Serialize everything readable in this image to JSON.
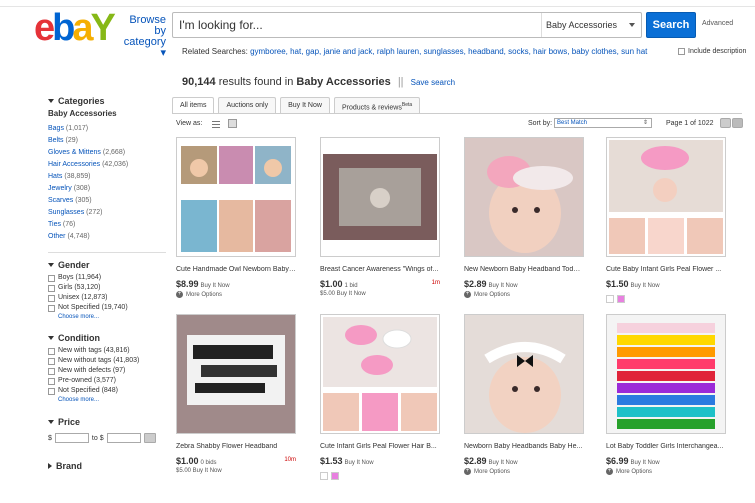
{
  "header": {
    "logo": {
      "e": "e",
      "b": "b",
      "a": "a",
      "y": "Y"
    },
    "browse_line1": "Browse by",
    "browse_line2": "category ▾",
    "search_placeholder": "I'm looking for...",
    "category_select": "Baby Accessories",
    "search_button": "Search",
    "advanced_link": "Advanced",
    "include_description": "Include description"
  },
  "related": {
    "label": "Related Searches:",
    "terms": [
      "gymboree,",
      "hat,",
      "gap,",
      "janie and jack,",
      "ralph lauren,",
      "sunglasses,",
      "headband,",
      "socks,",
      "hair bows,",
      "baby clothes,",
      "sun hat"
    ]
  },
  "results": {
    "count": "90,144",
    "found_in": "results found in",
    "category": "Baby Accessories",
    "separator": "||",
    "save_search": "Save search"
  },
  "sidebar": {
    "categories_heading": "Categories",
    "current_category": "Baby Accessories",
    "categories": [
      {
        "label": "Bags",
        "count": "(1,017)"
      },
      {
        "label": "Belts",
        "count": "(29)"
      },
      {
        "label": "Gloves & Mittens",
        "count": "(2,668)"
      },
      {
        "label": "Hair Accessories",
        "count": "(42,036)"
      },
      {
        "label": "Hats",
        "count": "(38,859)"
      },
      {
        "label": "Jewelry",
        "count": "(308)"
      },
      {
        "label": "Scarves",
        "count": "(305)"
      },
      {
        "label": "Sunglasses",
        "count": "(272)"
      },
      {
        "label": "Ties",
        "count": "(76)"
      },
      {
        "label": "Other",
        "count": "(4,748)"
      }
    ],
    "gender_heading": "Gender",
    "gender": [
      "Boys (11,964)",
      "Girls (53,120)",
      "Unisex (12,873)",
      "Not Specified (19,740)"
    ],
    "gender_more": "Choose more...",
    "condition_heading": "Condition",
    "condition_info": "i",
    "condition": [
      "New with tags (43,816)",
      "New without tags (41,803)",
      "New with defects (97)",
      "Pre-owned (3,577)",
      "Not Specified (848)"
    ],
    "condition_more": "Choose more...",
    "price_heading": "Price",
    "price_from": "$",
    "price_to": "to $",
    "brand_heading": "Brand"
  },
  "tabs": [
    {
      "label": "All items"
    },
    {
      "label": "Auctions only"
    },
    {
      "label": "Buy It Now"
    },
    {
      "label": "Products & reviews",
      "sup": "Beta"
    }
  ],
  "toolbar": {
    "view_as": "View as:",
    "sort_by": "Sort by:",
    "sort_value": "Best Match",
    "page": "Page 1 of 1022"
  },
  "items": [
    {
      "title": "Cute Handmade Owl Newborn Baby ...",
      "price": "$8.99",
      "format": "Buy It Now",
      "sub": "More Options",
      "swatches": []
    },
    {
      "title": "Breast Cancer Awareness \"Wings of...",
      "price": "$1.00",
      "format": "1 bid",
      "time_left": "1m",
      "sub": "$5.00 Buy It Now",
      "swatches": []
    },
    {
      "title": "New Newborn Baby Headband Toddl...",
      "price": "$2.89",
      "format": "Buy It Now",
      "sub": "More Options",
      "swatches": []
    },
    {
      "title": "Cute Baby Infant Girls Peal Flower ...",
      "price": "$1.50",
      "format": "Buy It Now",
      "sub": "",
      "swatches": [
        "#ffffff",
        "#e880e0"
      ]
    },
    {
      "title": "Zebra Shabby Flower Headband",
      "price": "$1.00",
      "format": "0 bids",
      "time_left": "10m",
      "sub": "$5.00 Buy It Now",
      "swatches": []
    },
    {
      "title": "Cute Infant Girls Peal Flower Hair B...",
      "price": "$1.53",
      "format": "Buy It Now",
      "sub": "",
      "swatches": [
        "#ffffff",
        "#e880e0"
      ]
    },
    {
      "title": "Newborn Baby Headbands Baby He...",
      "price": "$2.89",
      "format": "Buy It Now",
      "sub": "More Options",
      "swatches": []
    },
    {
      "title": "Lot Baby Toddler Girls Interchangea...",
      "price": "$6.99",
      "format": "Buy It Now",
      "sub": "More Options",
      "swatches": []
    }
  ],
  "colors": {
    "link": "#0654ba",
    "search_button": "#0a6fd6",
    "auction_time": "#cc0000"
  }
}
